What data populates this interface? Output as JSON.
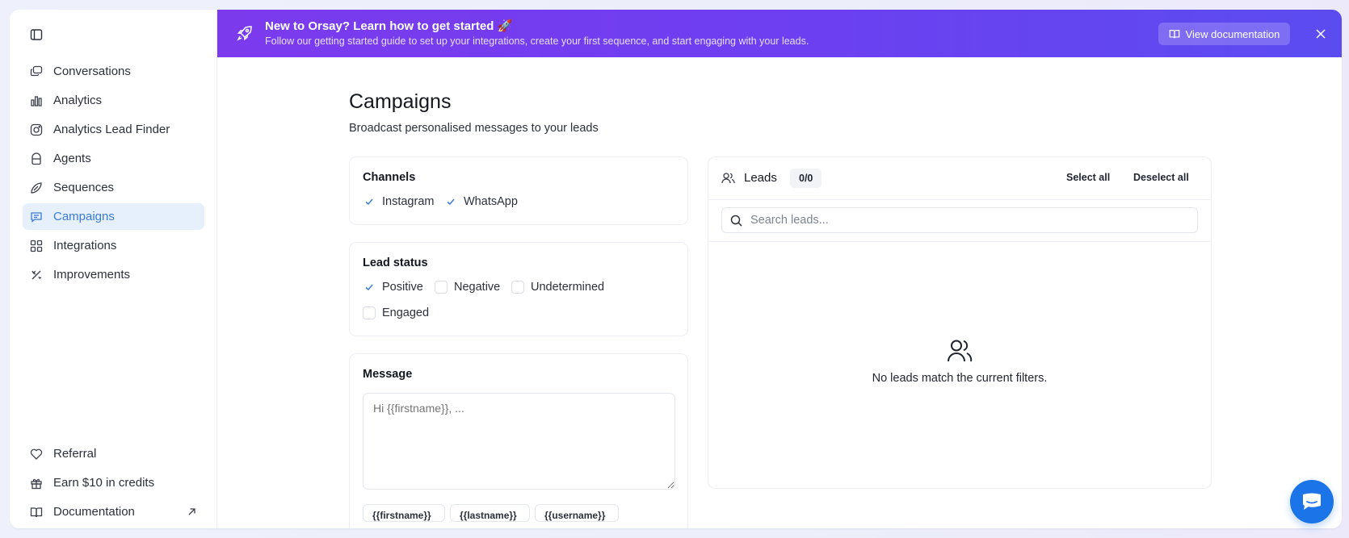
{
  "sidebar": {
    "items": [
      {
        "label": "Conversations",
        "icon": "chat-bubbles-icon"
      },
      {
        "label": "Analytics",
        "icon": "bar-chart-icon"
      },
      {
        "label": "Analytics Lead Finder",
        "icon": "instagram-icon"
      },
      {
        "label": "Agents",
        "icon": "agent-icon"
      },
      {
        "label": "Sequences",
        "icon": "sequence-icon"
      },
      {
        "label": "Campaigns",
        "icon": "megaphone-chat-icon",
        "active": true
      },
      {
        "label": "Integrations",
        "icon": "grid-icon"
      },
      {
        "label": "Improvements",
        "icon": "wand-icon"
      }
    ],
    "bottom": [
      {
        "label": "Referral",
        "icon": "heart-icon"
      },
      {
        "label": "Earn $10 in credits",
        "icon": "gift-icon"
      },
      {
        "label": "Documentation",
        "icon": "book-icon"
      }
    ]
  },
  "banner": {
    "title": "New to Orsay? Learn how to get started 🚀",
    "subtitle": "Follow our getting started guide to set up your integrations, create your first sequence, and start engaging with your leads.",
    "doc_button": "View documentation"
  },
  "page": {
    "title": "Campaigns",
    "subtitle": "Broadcast personalised messages to your leads"
  },
  "channels": {
    "title": "Channels",
    "options": [
      {
        "label": "Instagram",
        "checked": true
      },
      {
        "label": "WhatsApp",
        "checked": true
      }
    ]
  },
  "lead_status": {
    "title": "Lead status",
    "options": [
      {
        "label": "Positive",
        "checked": true
      },
      {
        "label": "Negative",
        "checked": false
      },
      {
        "label": "Undetermined",
        "checked": false
      },
      {
        "label": "Engaged",
        "checked": false
      }
    ]
  },
  "message": {
    "title": "Message",
    "placeholder": "Hi {{firstname}}, ...",
    "variables": [
      "{{firstname}}",
      "{{lastname}}",
      "{{username}}"
    ]
  },
  "leads": {
    "title": "Leads",
    "count": "0/0",
    "select_all": "Select all",
    "deselect_all": "Deselect all",
    "search_placeholder": "Search leads...",
    "empty_text": "No leads match the current filters."
  },
  "colors": {
    "accent": "#3a7bd5",
    "banner_start": "#7c3aed",
    "banner_end": "#5b4cf0",
    "chat_fab": "#1c74e9"
  }
}
